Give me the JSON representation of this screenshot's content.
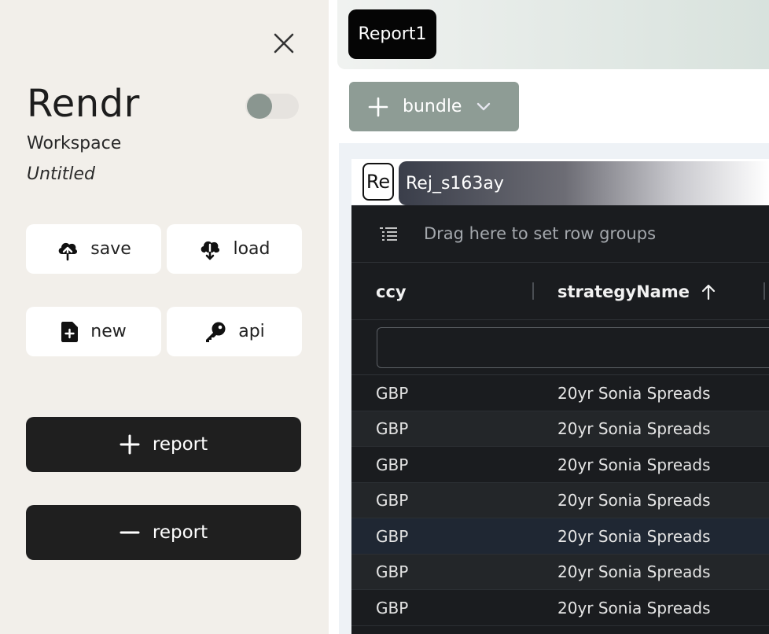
{
  "sidebar": {
    "title": "Rendr",
    "subtitle": "Workspace",
    "workspace_name": "Untitled",
    "toggle_on": false,
    "tiles": {
      "save": "save",
      "load": "load",
      "new": "new",
      "api": "api"
    },
    "add_report_label": "report",
    "remove_report_label": "report"
  },
  "reports": {
    "active_tab": "Report1"
  },
  "bundle": {
    "button_label": "bundle",
    "badge": "Re",
    "report_name": "Rej_s163ay"
  },
  "grid": {
    "row_groups_hint": "Drag here to set row groups",
    "columns": [
      {
        "label": "ccy",
        "sort": ""
      },
      {
        "label": "strategyName",
        "sort": "asc"
      }
    ],
    "filter_value": "",
    "rows": [
      [
        "GBP",
        "20yr Sonia Spreads"
      ],
      [
        "GBP",
        "20yr Sonia Spreads"
      ],
      [
        "GBP",
        "20yr Sonia Spreads"
      ],
      [
        "GBP",
        "20yr Sonia Spreads"
      ],
      [
        "GBP",
        "20yr Sonia Spreads"
      ],
      [
        "GBP",
        "20yr Sonia Spreads"
      ],
      [
        "GBP",
        "20yr Sonia Spreads"
      ]
    ]
  },
  "colors": {
    "sidebar_bg": "#f2efea",
    "dark_button": "#1f1f1f",
    "bundle_button": "#8e9c95",
    "grid_bg": "#1a1c1f",
    "selected_row": "#1f2733"
  }
}
